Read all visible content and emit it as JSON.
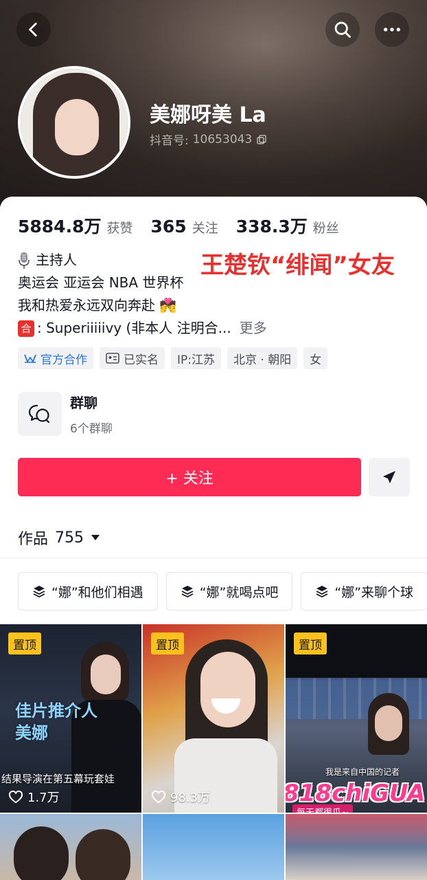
{
  "header": {
    "display_name": "美娜呀美 La",
    "douyin_id_label": "抖音号:",
    "douyin_id": "10653043"
  },
  "stats": [
    {
      "value": "5884.8万",
      "label": "获赞"
    },
    {
      "value": "365",
      "label": "关注"
    },
    {
      "value": "338.3万",
      "label": "粉丝"
    }
  ],
  "annotation": "王楚钦“绯闻”女友",
  "bio": {
    "line1": "主持人",
    "line2": "奥运会 亚运会 NBA 世界杯",
    "line3": "我和热爱永远双向奔赴",
    "line3_emoji": "💏",
    "line4_icon": "合",
    "line4": ": Superiiiiivy (非本人 注明合...",
    "more": "更多"
  },
  "tags": [
    {
      "label": "官方合作",
      "icon": "handshake-icon"
    },
    {
      "label": "已实名",
      "icon": "id-card-icon"
    },
    {
      "label": "IP:江苏"
    },
    {
      "label": "北京 · 朝阳"
    },
    {
      "label": "女"
    }
  ],
  "group_chat": {
    "title": "群聊",
    "subtitle": "6个群聊"
  },
  "follow_button": "+ 关注",
  "works_tab": {
    "label": "作品",
    "count": "755"
  },
  "collections": [
    {
      "label": "“娜”和他们相遇"
    },
    {
      "label": "“娜”就喝点吧"
    },
    {
      "label": "“娜”来聊个球"
    }
  ],
  "videos": [
    {
      "pinned": "置顶",
      "likes": "1.7万",
      "caption_line1": "佳片推介人",
      "caption_line2": "美娜",
      "subtitle": "结果导演在第五幕玩套娃"
    },
    {
      "pinned": "置顶",
      "likes": "98.3万"
    },
    {
      "pinned": "置顶",
      "overlay_text": "我是来自中国的记者",
      "logo": "818chiGUA",
      "logo_sub": "每天都很瓜~"
    }
  ],
  "colors": {
    "accent": "#fe2c55",
    "annotation": "#e8312e",
    "pin": "#fcc11c",
    "official_tag": "#2a78d6"
  }
}
